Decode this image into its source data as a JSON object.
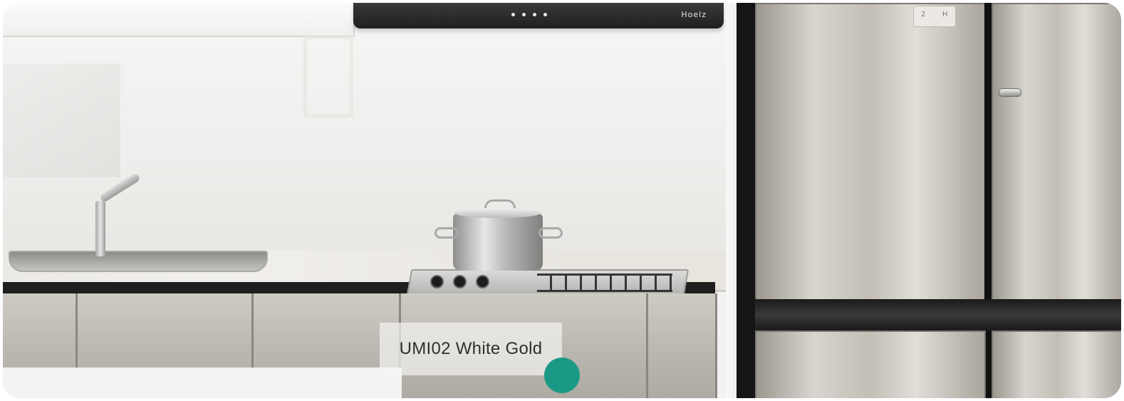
{
  "photo": {
    "subject": "Kitchen with countertop, cooktop and stainless refrigerator",
    "hood_brand": "Hoelz"
  },
  "caption": {
    "label": "UMI02 White Gold"
  },
  "marker": {
    "color": "#1a9a86"
  }
}
